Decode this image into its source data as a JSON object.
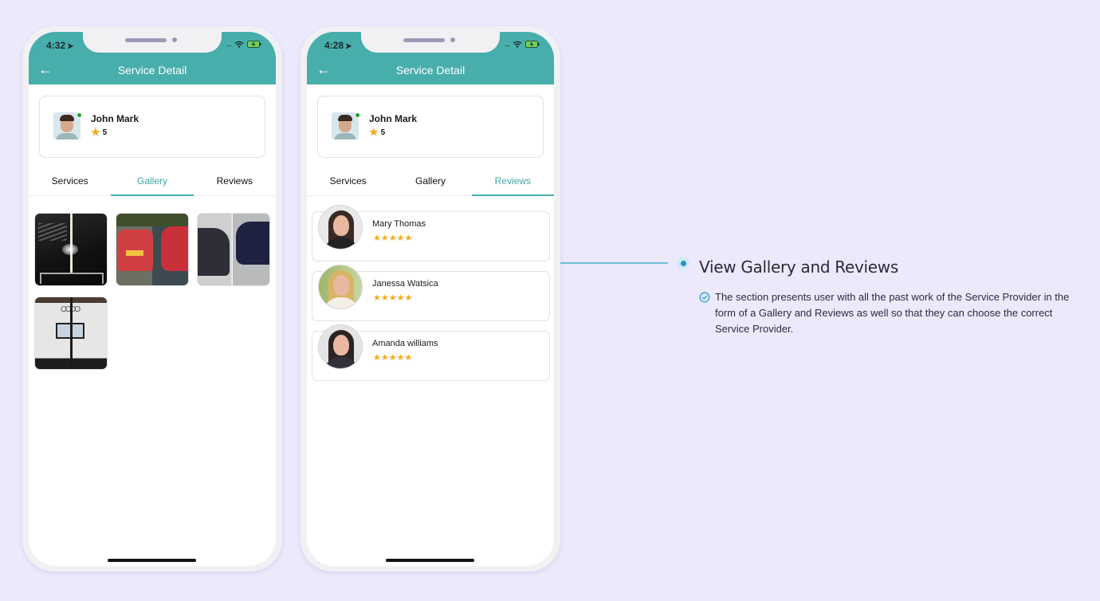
{
  "phones": [
    {
      "status_time": "4:32",
      "header_title": "Service Detail",
      "provider": {
        "name": "John Mark",
        "rating": "5",
        "online": true
      },
      "tabs": [
        {
          "label": "Services",
          "active": false
        },
        {
          "label": "Gallery",
          "active": true
        },
        {
          "label": "Reviews",
          "active": false
        }
      ],
      "gallery": [
        {
          "name": "car-hood-scratch-repair"
        },
        {
          "name": "red-mini-before-after"
        },
        {
          "name": "mercedes-before-after"
        },
        {
          "name": "white-audi-before-after"
        }
      ]
    },
    {
      "status_time": "4:28",
      "header_title": "Service Detail",
      "provider": {
        "name": "John Mark",
        "rating": "5",
        "online": true
      },
      "tabs": [
        {
          "label": "Services",
          "active": false
        },
        {
          "label": "Gallery",
          "active": false
        },
        {
          "label": "Reviews",
          "active": true
        }
      ],
      "reviews": [
        {
          "name": "Mary Thomas",
          "stars": 5,
          "stars_text": "★★★★★"
        },
        {
          "name": "Janessa Watsica",
          "stars": 5,
          "stars_text": "★★★★★"
        },
        {
          "name": "Amanda williams",
          "stars": 5,
          "stars_text": "★★★★★"
        }
      ]
    }
  ],
  "icons": {
    "back": "←",
    "location_arrow": "➤",
    "star": "★",
    "signal": "....",
    "check": "check-circle-icon"
  },
  "feature": {
    "title": "View Gallery and Reviews",
    "description": "The section presents user with all the past work of the Service Provider in the form of a Gallery and Reviews as well so that they can choose the correct Service Provider."
  },
  "colors": {
    "background": "#ece9fc",
    "header": "#48aeab",
    "accent": "#3fa7a5",
    "star": "#f7a91b",
    "online": "#1aa520",
    "connector": "#6bbdd6"
  }
}
